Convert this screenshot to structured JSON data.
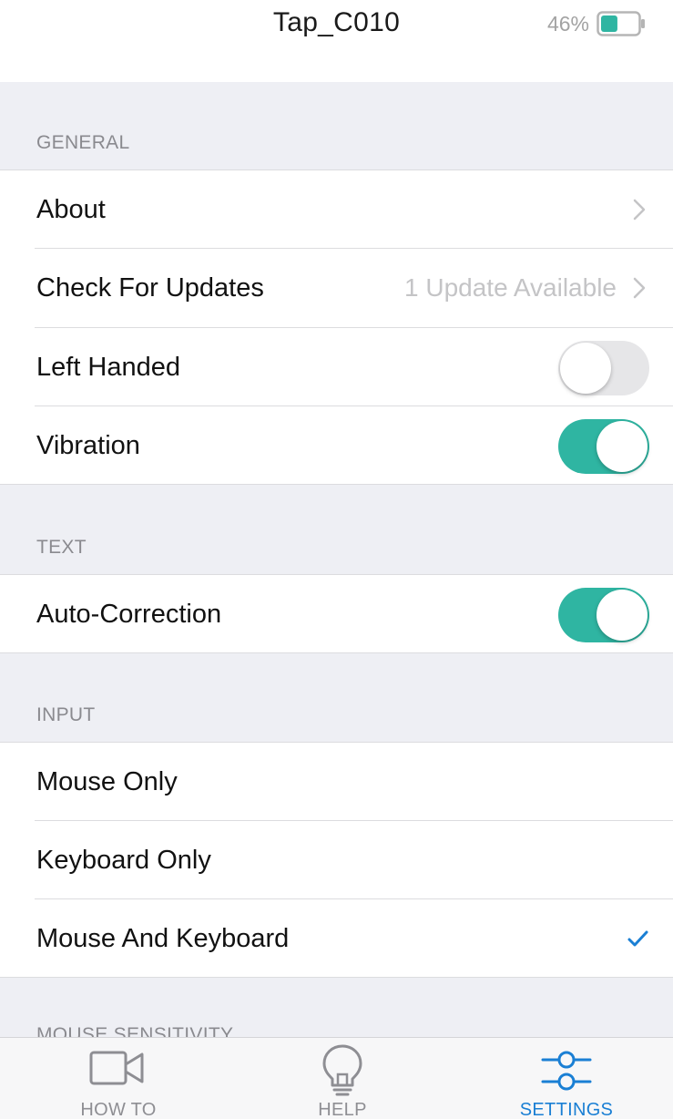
{
  "header": {
    "title": "Tap_C010",
    "battery_percent": "46%",
    "battery_level": 0.46,
    "battery_color": "#2fb5a2"
  },
  "sections": {
    "general": {
      "header": "GENERAL",
      "about": {
        "label": "About"
      },
      "updates": {
        "label": "Check For Updates",
        "detail": "1 Update Available"
      },
      "left_handed": {
        "label": "Left Handed",
        "on": false
      },
      "vibration": {
        "label": "Vibration",
        "on": true
      }
    },
    "text": {
      "header": "TEXT",
      "autocorrect": {
        "label": "Auto-Correction",
        "on": true
      }
    },
    "input": {
      "header": "INPUT",
      "mouse_only": {
        "label": "Mouse Only"
      },
      "keyboard_only": {
        "label": "Keyboard Only"
      },
      "mouse_keyboard": {
        "label": "Mouse And Keyboard",
        "selected": true
      }
    },
    "mouse_sensitivity": {
      "header": "MOUSE SENSITIVITY"
    }
  },
  "tabs": {
    "howto": {
      "label": "HOW TO",
      "icon": "video-camera-icon"
    },
    "help": {
      "label": "HELP",
      "icon": "lightbulb-icon"
    },
    "settings": {
      "label": "SETTINGS",
      "icon": "sliders-icon",
      "active": true
    }
  },
  "colors": {
    "accent": "#1a7fd4",
    "toggle_on": "#2fb5a2",
    "section_bg": "#eeeff4"
  }
}
